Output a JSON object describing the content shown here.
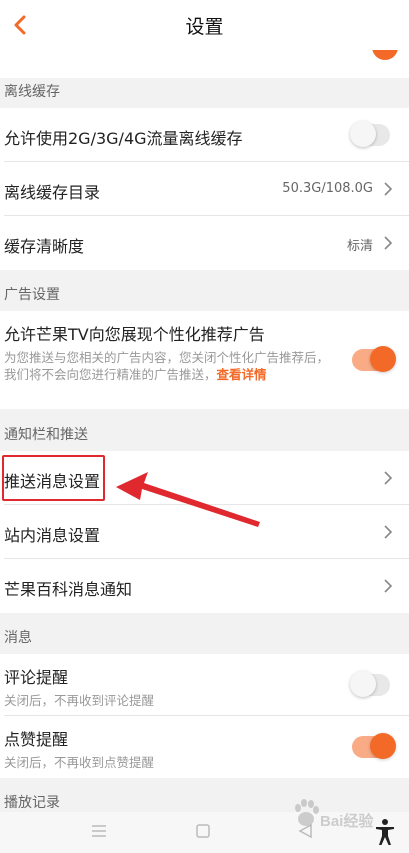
{
  "header": {
    "title": "设置",
    "back_icon": "chevron-left-icon"
  },
  "offline_cache": {
    "section_title": "离线缓存",
    "allow_mobile_data": {
      "label": "允许使用2G/3G/4G流量离线缓存",
      "enabled": false
    },
    "cache_directory": {
      "label": "离线缓存目录",
      "value": "50.3G/108.0G"
    },
    "cache_quality": {
      "label": "缓存清晰度",
      "value": "标清"
    }
  },
  "ad_settings": {
    "section_title": "广告设置",
    "personalized_ads": {
      "label": "允许芒果TV向您展现个性化推荐广告",
      "description": "为您推送与您相关的广告内容，您关闭个性化广告推荐后，我们将不会向您进行精准的广告推送，",
      "link_text": "查看详情",
      "enabled": true
    }
  },
  "notifications": {
    "section_title": "通知栏和推送",
    "push_message_settings": {
      "label": "推送消息设置"
    },
    "in_app_message_settings": {
      "label": "站内消息设置"
    },
    "baike_notifications": {
      "label": "芒果百科消息通知"
    }
  },
  "messages": {
    "section_title": "消息",
    "comment_reminder": {
      "label": "评论提醒",
      "sub": "关闭后，不再收到评论提醒",
      "enabled": false
    },
    "like_reminder": {
      "label": "点赞提醒",
      "sub": "关闭后，不再收到点赞提醒",
      "enabled": true
    }
  },
  "playback_history": {
    "section_title": "播放记录"
  },
  "watermark": {
    "text": "Bai经验"
  },
  "colors": {
    "accent": "#f36a28",
    "annotation": "#e0282f"
  }
}
